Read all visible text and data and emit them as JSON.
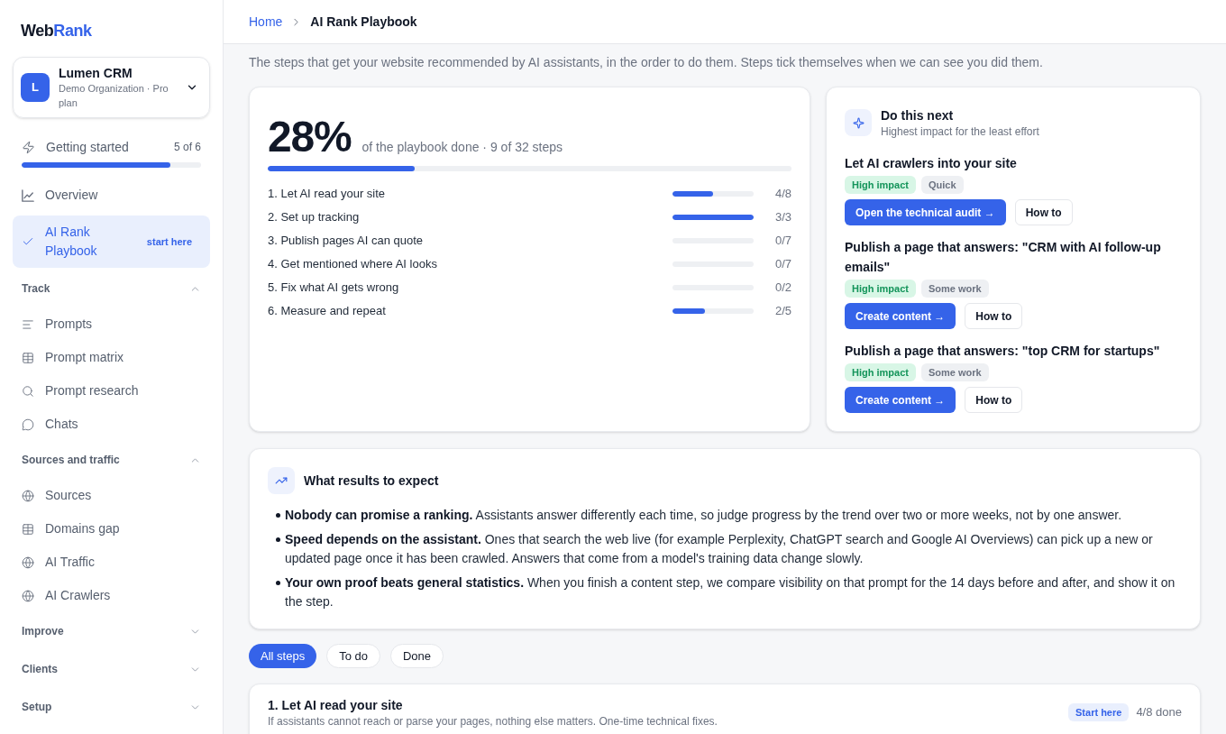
{
  "sidebar": {
    "logo": {
      "text": "Web",
      "accent": "Rank"
    },
    "organization": {
      "avatar": "L",
      "name": "Lumen CRM",
      "plan": "Demo Organization · Pro plan"
    },
    "getting_started": {
      "label": "Getting started",
      "count": "5 of 6",
      "level": 0.83
    },
    "items": [
      {
        "label": "Overview",
        "selected": false
      },
      {
        "label": "AI Rank Playbook",
        "badge": "start here",
        "selected": true
      }
    ],
    "sections": [
      {
        "title": "Track",
        "expanded": true,
        "items": [
          {
            "label": "Prompts",
            "selected": false
          },
          {
            "label": "Prompt matrix",
            "selected": false
          },
          {
            "label": "Prompt research",
            "selected": false
          },
          {
            "label": "Chats",
            "selected": false
          }
        ]
      },
      {
        "title": "Sources and traffic",
        "expanded": true,
        "items": [
          {
            "label": "Sources",
            "selected": false
          },
          {
            "label": "Domains gap",
            "selected": false
          },
          {
            "label": "AI Traffic",
            "selected": false
          },
          {
            "label": "AI Crawlers",
            "selected": false
          }
        ]
      },
      {
        "title": "Improve",
        "expanded": false
      },
      {
        "title": "Clients",
        "expanded": false
      },
      {
        "title": "Setup",
        "expanded": false
      }
    ]
  },
  "breadcrumb": [
    {
      "label": "Home"
    },
    {
      "label": "AI Rank Playbook"
    }
  ],
  "subtitle": "The steps that get your website recommended by AI assistants, in the order to do them. Steps tick themselves when we can see you did them.",
  "progress_card": {
    "percent": "28%",
    "summary": "of the playbook done · 9 of 32 steps",
    "level": 0.28,
    "steps": [
      {
        "label": "1. Let AI read your site",
        "level": 0.5,
        "count": "4/8"
      },
      {
        "label": "2. Set up tracking",
        "level": 1,
        "count": "3/3"
      },
      {
        "label": "3. Publish pages AI can quote",
        "level": 0,
        "count": "0/7"
      },
      {
        "label": "4. Get mentioned where AI looks",
        "level": 0,
        "count": "0/7"
      },
      {
        "label": "5. Fix what AI gets wrong",
        "level": 0,
        "count": "0/2"
      },
      {
        "label": "6. Measure and repeat",
        "level": 0.4,
        "count": "2/5"
      }
    ]
  },
  "next_card": {
    "title": "Do this next",
    "subtitle": "Highest impact for the least effort",
    "actions": [
      {
        "title": "Let AI crawlers into your site",
        "tags": [
          {
            "label": "High impact",
            "kind": "impact"
          },
          {
            "label": "Quick",
            "kind": "effort"
          }
        ],
        "primary_button": "Open the technical audit →",
        "secondary_button": "How to"
      },
      {
        "title": "Publish a page that answers: \"CRM with AI follow-up emails\"",
        "tags": [
          {
            "label": "High impact",
            "kind": "impact"
          },
          {
            "label": "Some work",
            "kind": "effort"
          }
        ],
        "primary_button": "Create content →",
        "secondary_button": "How to"
      },
      {
        "title": "Publish a page that answers: \"top CRM for startups\"",
        "tags": [
          {
            "label": "High impact",
            "kind": "impact"
          },
          {
            "label": "Some work",
            "kind": "effort"
          }
        ],
        "primary_button": "Create content →",
        "secondary_button": "How to"
      }
    ]
  },
  "results_card": {
    "title": "What results to expect",
    "points": [
      "**Nobody can promise a ranking.** Assistants answer differently each time, so judge progress by the trend over two or more weeks, not by one answer.",
      "**Speed depends on the assistant.** Ones that search the web live (for example Perplexity, ChatGPT search and Google AI Overviews) can pick up a new or updated page once it has been crawled. Answers that come from a model's training data change slowly.",
      "**Your own proof beats general statistics.** When you finish a content step, we compare visibility on that prompt for the 14 days before and after, and show it on the step."
    ]
  },
  "filters": [
    {
      "label": "All steps",
      "selected": true
    },
    {
      "label": "To do",
      "selected": false
    },
    {
      "label": "Done",
      "selected": false
    }
  ],
  "step_cards": [
    {
      "title": "1. Let AI read your site",
      "description": "If assistants cannot reach or parse your pages, nothing else matters. One-time technical fixes.",
      "badge": "Start here",
      "count": "4/8 done"
    }
  ]
}
